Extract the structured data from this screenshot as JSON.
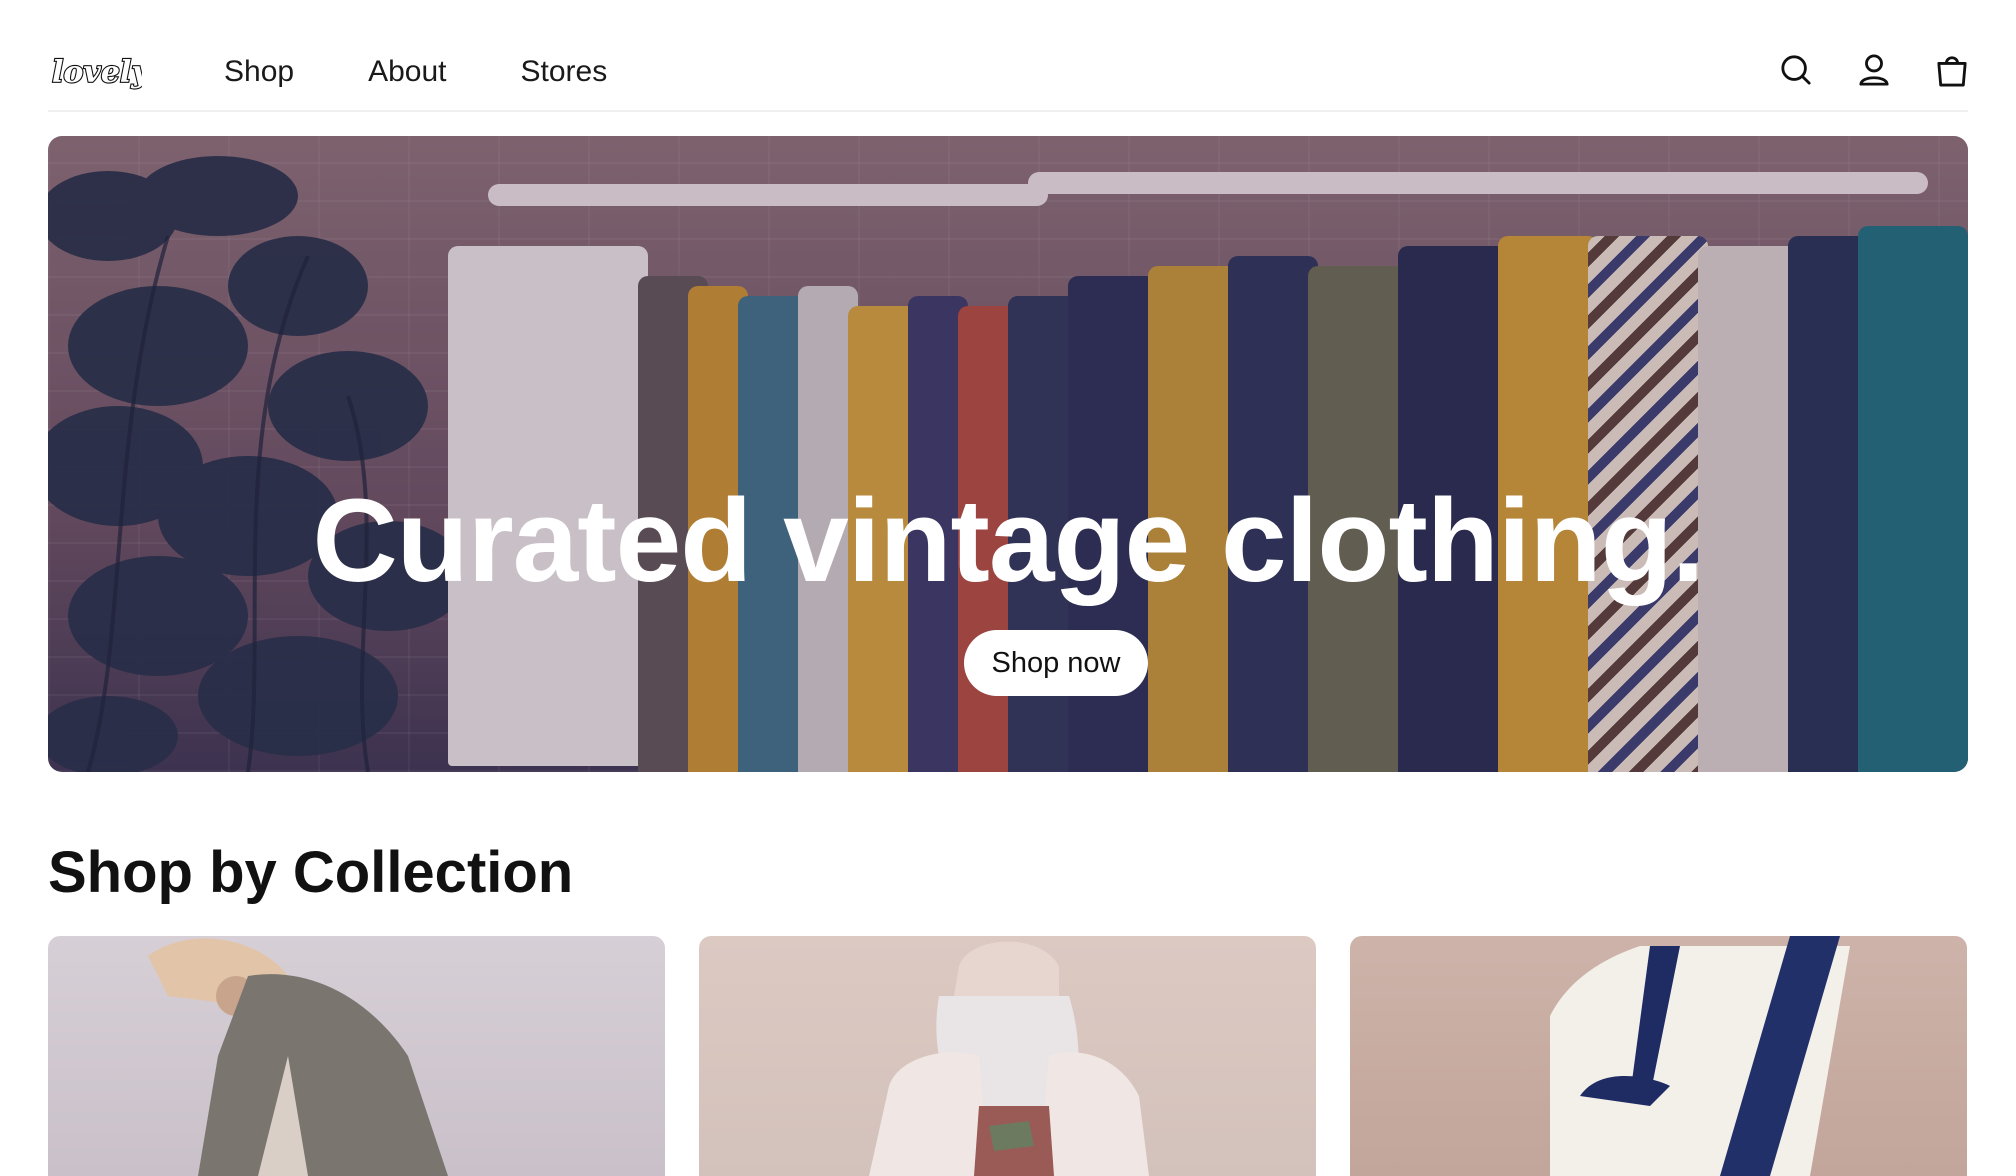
{
  "brand": {
    "logo_text": "lovely"
  },
  "nav": {
    "items": [
      "Shop",
      "About",
      "Stores"
    ]
  },
  "header_icons": [
    "search-icon",
    "account-icon",
    "cart-bag-icon"
  ],
  "hero": {
    "headline": "Curated vintage clothing.",
    "cta_label": "Shop now"
  },
  "collections": {
    "title": "Shop by Collection",
    "cards": [
      {
        "name": "collection-card-1",
        "image": "person-in-cap-and-jacket"
      },
      {
        "name": "collection-card-2",
        "image": "person-in-bucket-hat"
      },
      {
        "name": "collection-card-3",
        "image": "sneaker-closeup"
      }
    ]
  },
  "colors": {
    "text": "#111111",
    "hero_button_bg": "#ffffff",
    "divider": "#efefef"
  }
}
